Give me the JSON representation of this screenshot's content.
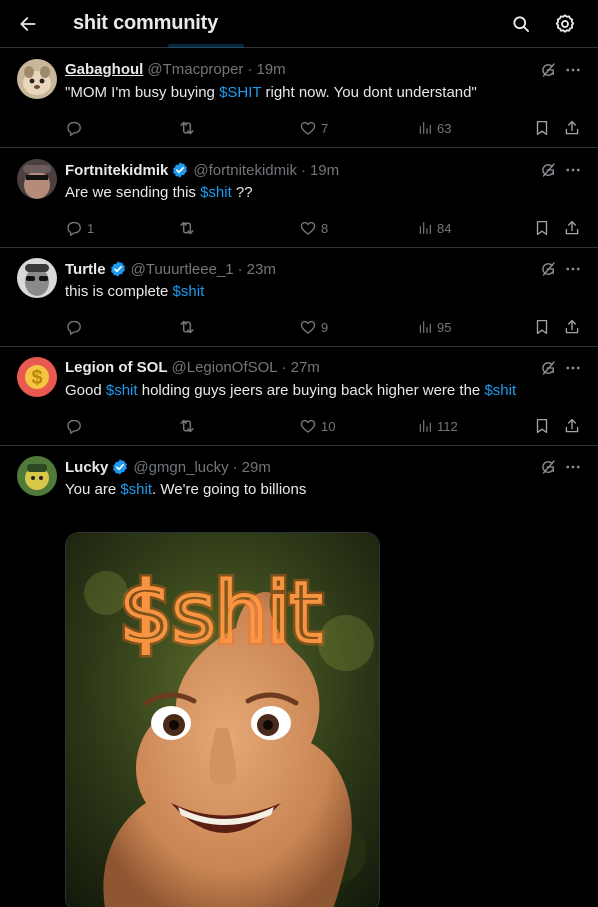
{
  "header": {
    "title": "shit community"
  },
  "posts": [
    {
      "display_name": "Gabaghoul",
      "handle": "@Tmacproper",
      "time": "19m",
      "text_before": "\"MOM I'm busy buying ",
      "tag": "$SHIT",
      "text_after": " right now. You dont understand\"",
      "replies": "",
      "reposts": "",
      "likes": "7",
      "views": "63"
    },
    {
      "display_name": "Fortnitekidmik",
      "handle": "@fortnitekidmik",
      "time": "19m",
      "text_before": "Are we sending this ",
      "tag": "$shit",
      "text_after": " ??",
      "replies": "1",
      "reposts": "",
      "likes": "8",
      "views": "84"
    },
    {
      "display_name": "Turtle",
      "handle": "@Tuuurtleee_1",
      "time": "23m",
      "text_before": "this is complete ",
      "tag": "$shit",
      "text_after": "",
      "replies": "",
      "reposts": "",
      "likes": "9",
      "views": "95"
    },
    {
      "display_name": "Legion of SOL",
      "handle": "@LegionOfSOL",
      "time": "27m",
      "text_before": "Good ",
      "tag": "$shit",
      "text_middle": " holding guys jeers are buying back higher were the ",
      "tag2": "$shit",
      "replies": "",
      "reposts": "",
      "likes": "10",
      "views": "112"
    },
    {
      "display_name": "Lucky",
      "handle": "@gmgn_lucky",
      "time": "29m",
      "text_before": "You are ",
      "tag": "$shit",
      "text_after": ". We're going to billions",
      "media_text": "$shit"
    }
  ],
  "separator": "·",
  "colors": {
    "background": "#000000",
    "text": "#e7e9ea",
    "muted": "#71767b",
    "accent": "#1d9bf0",
    "border": "#2f3336"
  },
  "icons": {
    "back": "arrow-left-icon",
    "search": "search-icon",
    "settings": "gear-icon",
    "reply": "reply-icon",
    "repost": "repost-icon",
    "like": "heart-icon",
    "views": "views-icon",
    "bookmark": "bookmark-icon",
    "share": "share-icon",
    "grok": "grok-icon",
    "more": "more-icon",
    "verified": "verified-badge-icon"
  }
}
